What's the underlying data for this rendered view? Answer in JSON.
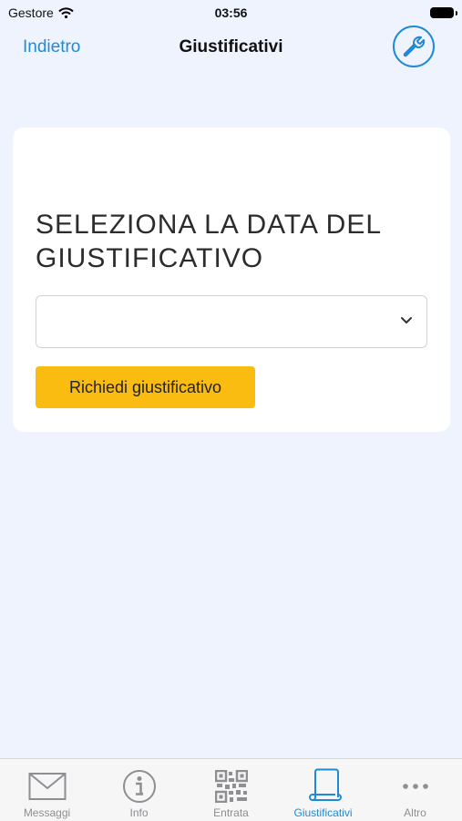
{
  "status_bar": {
    "carrier": "Gestore",
    "time": "03:56"
  },
  "nav": {
    "back_label": "Indietro",
    "title": "Giustificativi",
    "settings_icon": "wrench-icon"
  },
  "card": {
    "title": "SELEZIONA LA DATA DEL GIUSTIFICATIVO",
    "date_select": {
      "value": ""
    },
    "request_button": "Richiedi giustificativo"
  },
  "tabs": [
    {
      "label": "Messaggi",
      "icon": "envelope-icon",
      "active": false
    },
    {
      "label": "Info",
      "icon": "info-icon",
      "active": false
    },
    {
      "label": "Entrata",
      "icon": "qr-code-icon",
      "active": false
    },
    {
      "label": "Giustificativi",
      "icon": "scroll-icon",
      "active": true
    },
    {
      "label": "Altro",
      "icon": "more-icon",
      "active": false
    }
  ],
  "colors": {
    "accent": "#1f8ad8",
    "button": "#fbbc12",
    "background": "#eef3fd",
    "inactive_tab": "#8e8e93"
  }
}
